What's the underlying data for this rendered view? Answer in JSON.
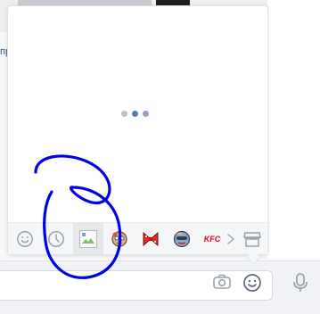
{
  "background": {
    "partial_text": "пр"
  },
  "popup": {
    "loader_dots": [
      "#b8c1cc",
      "#5c7ea4",
      "#8fa5bd"
    ],
    "tabs": [
      {
        "name": "emoji-tab",
        "icon": "smile-outline"
      },
      {
        "name": "recent-tab",
        "icon": "clock"
      },
      {
        "name": "broken-image-tab",
        "icon": "broken-image"
      },
      {
        "name": "sticker-pack-1-tab",
        "icon": "sticker-character"
      },
      {
        "name": "sticker-pack-2-tab",
        "icon": "red-bow"
      },
      {
        "name": "sticker-pack-3-tab",
        "icon": "sticker-character-2"
      },
      {
        "name": "sticker-pack-kfc-tab",
        "icon": "kfc-logo",
        "label": "KFC"
      }
    ]
  },
  "composer": {
    "icons": [
      "camera-icon",
      "smile-icon",
      "microphone-icon"
    ]
  },
  "annotation": {
    "color": "#0000e6"
  }
}
